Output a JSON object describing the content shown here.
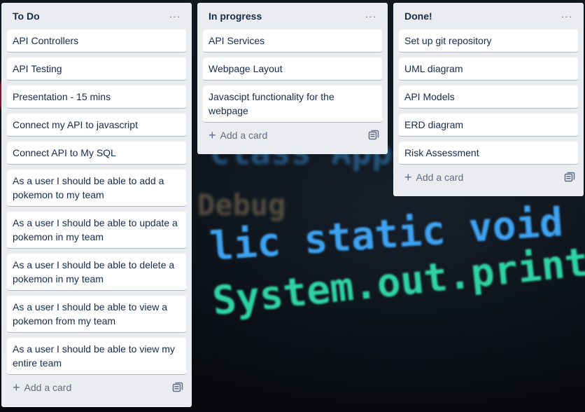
{
  "background": {
    "code_lines": [
      "class App {",
      "Debug",
      "lic static void main",
      "System.out.println"
    ],
    "colors": {
      "teal": "#2fd3a3",
      "blue": "#3ea2f0",
      "yellow": "#f3d44a",
      "list_bg": "#ebecf0",
      "card_bg": "#ffffff",
      "text": "#172b4d",
      "muted": "#5e6c84"
    }
  },
  "lists": [
    {
      "title": "To Do",
      "menu_icon": "more-horizontal-icon",
      "cards": [
        "API Controllers",
        "API Testing",
        "Presentation - 15 mins",
        "Connect my API to javascript",
        "Connect API to My SQL",
        "As a user I should be able to add a pokemon to my team",
        "As a user I should be able to update a pokemon in my team",
        "As a user I should be able to delete a pokemon in my team",
        "As a user I should be able to view a pokemon from my team",
        "As a user I should be able to view my entire team"
      ],
      "add_card_label": "Add a card",
      "template_icon": "card-template-icon"
    },
    {
      "title": "In progress",
      "menu_icon": "more-horizontal-icon",
      "cards": [
        "API Services",
        "Webpage Layout",
        "Javascipt functionality for the webpage"
      ],
      "add_card_label": "Add a card",
      "template_icon": "card-template-icon"
    },
    {
      "title": "Done!",
      "menu_icon": "more-horizontal-icon",
      "cards": [
        "Set up git repository",
        "UML diagram",
        "API Models",
        "ERD diagram",
        "Risk Assessment"
      ],
      "add_card_label": "Add a card",
      "template_icon": "card-template-icon"
    }
  ],
  "icons": {
    "menu": "···",
    "plus": "+"
  }
}
